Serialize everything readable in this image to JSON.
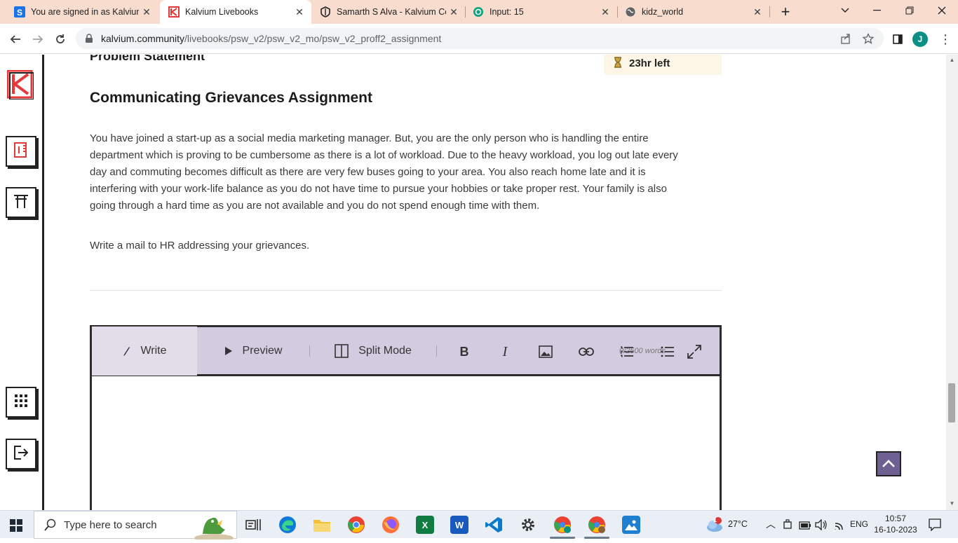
{
  "browser": {
    "tabs": [
      {
        "title": "You are signed in as Kalvium",
        "favicon_color": "#1a73e8"
      },
      {
        "title": "Kalvium Livebooks",
        "favicon_color": "#e5383b"
      },
      {
        "title": "Samarth S Alva - Kalvium Co",
        "favicon_color": "#202124"
      },
      {
        "title": "Input: 15",
        "favicon_color": "#10a37f"
      },
      {
        "title": "kidz_world",
        "favicon_color": "#5f6368"
      }
    ],
    "new_tab_label": "+",
    "url_host": "kalvium.community",
    "url_path": "/livebooks/psw_v2/psw_v2_mo/psw_v2_proff2_assignment",
    "profile_initial": "J"
  },
  "page": {
    "problem_heading": "Problem Statement",
    "timer_text": "23hr left",
    "assignment_title": "Communicating Grievances Assignment",
    "paragraph_lines": [
      "You have joined a start-up as a social media marketing manager. But, you are the only person who is handling the entire",
      "department which is proving to be cumbersome as there is a lot of workload. Due to the heavy workload, you log out late every",
      "day and commuting becomes difficult as there are very few buses going to your area. You also reach home late and it is",
      "interfering with your work-life balance as you do not have time to pursue your hobbies or take proper rest. Your family is also",
      "going through a hard time as you are not available and you do not spend enough time with them."
    ],
    "instruction": "Write a mail to HR addressing your grievances.",
    "editor": {
      "write_label": "Write",
      "preview_label": "Preview",
      "split_label": "Split Mode",
      "word_count": "0/2500 words",
      "accent": "#d3cce0"
    }
  },
  "taskbar": {
    "search_placeholder": "Type here to search",
    "weather_temp": "27°C",
    "weather_badge": "1",
    "language": "ENG",
    "time": "10:57",
    "date": "16-10-2023"
  }
}
